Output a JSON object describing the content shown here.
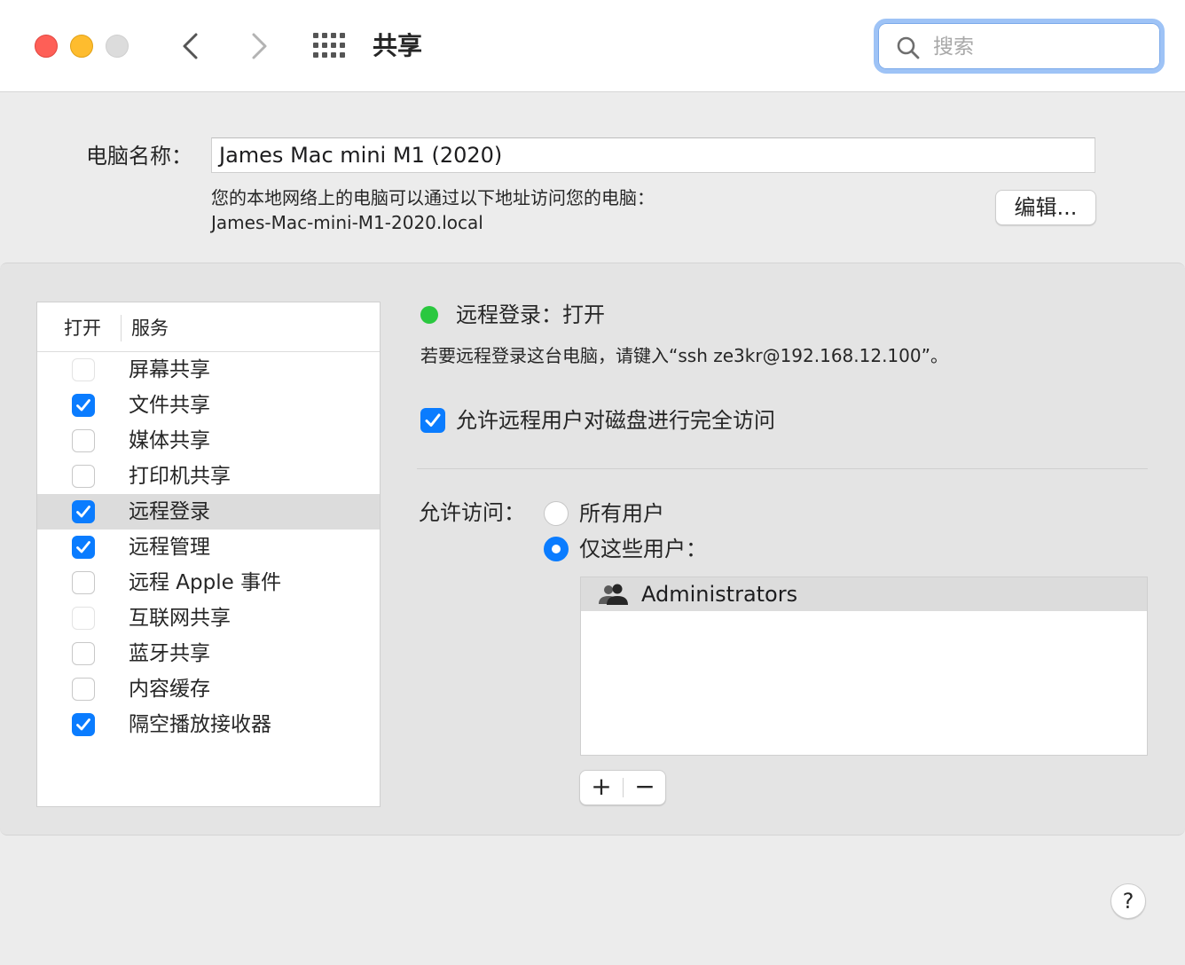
{
  "window": {
    "title": "共享"
  },
  "search": {
    "placeholder": "搜索"
  },
  "computer_name": {
    "label": "电脑名称：",
    "value": "James Mac mini M1 (2020)",
    "address_description": "您的本地网络上的电脑可以通过以下地址访问您的电脑：",
    "address": "James-Mac-mini-M1-2020.local",
    "edit_label": "编辑..."
  },
  "services": {
    "header_on": "打开",
    "header_service": "服务",
    "items": [
      {
        "label": "屏幕共享",
        "checked": false,
        "disabled": true
      },
      {
        "label": "文件共享",
        "checked": true
      },
      {
        "label": "媒体共享",
        "checked": false
      },
      {
        "label": "打印机共享",
        "checked": false
      },
      {
        "label": "远程登录",
        "checked": true,
        "selected": true
      },
      {
        "label": "远程管理",
        "checked": true
      },
      {
        "label": "远程 Apple 事件",
        "checked": false
      },
      {
        "label": "互联网共享",
        "checked": false,
        "disabled": true
      },
      {
        "label": "蓝牙共享",
        "checked": false
      },
      {
        "label": "内容缓存",
        "checked": false
      },
      {
        "label": "隔空播放接收器",
        "checked": true
      }
    ]
  },
  "detail": {
    "status": "远程登录：打开",
    "status_color": "#2ac83f",
    "instructions": "若要远程登录这台电脑，请键入“ssh ze3kr@192.168.12.100”。",
    "full_disk_access_label": "允许远程用户对磁盘进行完全访问",
    "full_disk_access_checked": true,
    "allow_access_label": "允许访问：",
    "option_all_users": "所有用户",
    "option_only_users": "仅这些用户：",
    "selected_option": "only",
    "users": [
      {
        "name": "Administrators",
        "icon": "group-icon"
      }
    ],
    "add_label": "+",
    "remove_label": "−"
  },
  "help": {
    "label": "?"
  },
  "colors": {
    "accent": "#0a7cff",
    "search_focus": "#9ec3f6"
  }
}
